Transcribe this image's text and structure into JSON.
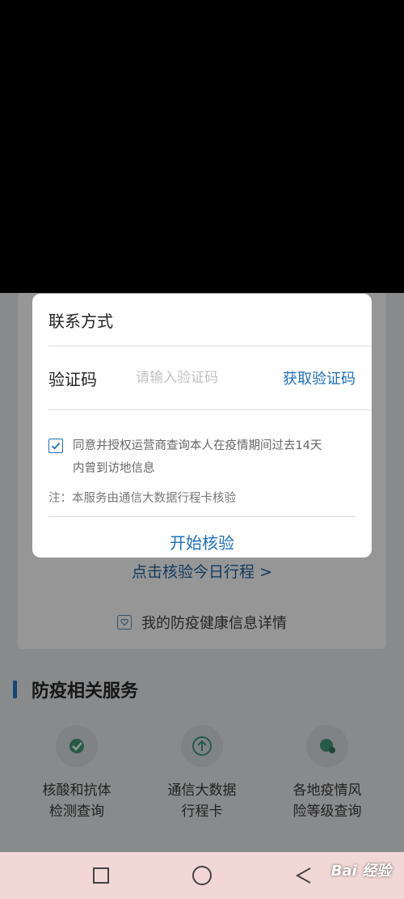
{
  "dialog": {
    "contact_label": "联系方式",
    "code_label": "验证码",
    "code_placeholder": "请输入验证码",
    "code_value": "",
    "get_code_label": "获取验证码",
    "consent_checked": true,
    "consent_text_line1": "同意并授权运营商查询本人在疫情期间过去14天",
    "consent_text_line2": "内曾到访地信息",
    "note": "注：本服务由通信大数据行程卡核验",
    "start_label": "开始核验"
  },
  "background": {
    "check_today_link": "点击核验今日行程 >",
    "health_info_link": "我的防疫健康信息详情",
    "section_title": "防疫相关服务",
    "services": [
      {
        "line1": "核酸和抗体",
        "line2": "检测查询",
        "icon": "virus-test-icon"
      },
      {
        "line1": "通信大数据",
        "line2": "行程卡",
        "icon": "arrow-up-circle-icon"
      },
      {
        "line1": "各地疫情风",
        "line2": "险等级查询",
        "icon": "virus-map-icon"
      }
    ]
  },
  "navbar": {
    "watermark": "Bai 经验"
  },
  "colors": {
    "accent": "#1e6fb9",
    "navbar_bg": "#f1d7d6"
  }
}
